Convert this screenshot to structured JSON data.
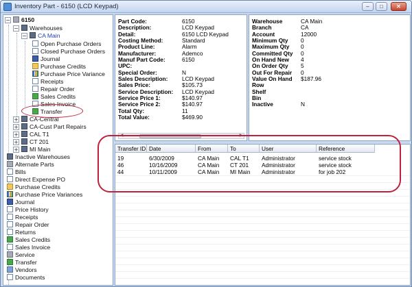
{
  "window": {
    "title": "Inventory Part -  6150 (LCD Keypad)",
    "buttons": {
      "minimize": "–",
      "maximize": "□",
      "close": "✕"
    }
  },
  "tree": {
    "root": "6150",
    "warehouses": "Warehouses",
    "ca_main": "CA Main",
    "ca_main_children": [
      "Open Purchase Orders",
      "Closed Purchase Orders",
      "Journal",
      "Purchase Credits",
      "Purchase Price Variance",
      "Receipts",
      "Repair Order",
      "Sales Credits",
      "Sales Invoice",
      "Transfer"
    ],
    "other_warehouses": [
      "CA-Central",
      "CA-Cust Part Repairs",
      "CAL T1",
      "CT 201",
      "MI Main"
    ],
    "top_items": [
      "Inactive Warehouses",
      "Alternate Parts",
      "Bills",
      "Direct Expense PO",
      "Purchase Credits",
      "Purchase Price Variances",
      "Journal",
      "Price History",
      "Receipts",
      "Repair Order",
      "Returns",
      "Sales Credits",
      "Sales Invoice",
      "Service",
      "Transfer",
      "Vendors",
      "Documents"
    ]
  },
  "part": {
    "labels": [
      "Part Code:",
      "Description:",
      "Detail:",
      "Costing Method:",
      "Product Line:",
      "Manufacturer:",
      "Manuf Part Code:",
      "UPC:",
      "Special Order:",
      "Sales Description:",
      "Sales Price:",
      "Service Description:",
      "Service Price 1:",
      "Service Price 2:",
      "Total Qty:",
      "Total Value:"
    ],
    "values": [
      "6150",
      "LCD Keypad",
      "6150 LCD Keypad",
      "Standard",
      "Alarm",
      "Ademco",
      "6150",
      "",
      "N",
      "LCD Keypad",
      "$105.73",
      "LCD Keypad",
      "$140.97",
      "$140.97",
      "11",
      "$469.90"
    ]
  },
  "warehouse": {
    "labels": [
      "Warehouse",
      "Branch",
      "Account",
      "Minimum Qty",
      "Maximum Qty",
      "Committed Qty",
      "On Hand New",
      "On Order Qty",
      "Out For Repair",
      "Value On Hand",
      "Row",
      "Shelf",
      "Bin",
      "Inactive"
    ],
    "values": [
      "CA Main",
      "CA",
      "12000",
      "0",
      "0",
      "0",
      "4",
      "5",
      "0",
      "$187.96",
      "",
      "",
      "",
      "N"
    ]
  },
  "transfers": {
    "columns": [
      "Transfer ID",
      "Date",
      "From",
      "To",
      "User",
      "Reference"
    ],
    "rows": [
      [
        "19",
        "6/30/2009",
        "CA Main",
        "CAL T1",
        "Administrator",
        "service stock"
      ],
      [
        "46",
        "10/16/2009",
        "CA Main",
        "CT 201",
        "Administrator",
        "service stock"
      ],
      [
        "44",
        "10/11/2009",
        "CA Main",
        "MI Main",
        "Administrator",
        "for job 202"
      ]
    ]
  },
  "colors": {
    "annotation": "#c0203a",
    "selected_text": "#1f3fb0",
    "frame": "#c9d9ef"
  }
}
